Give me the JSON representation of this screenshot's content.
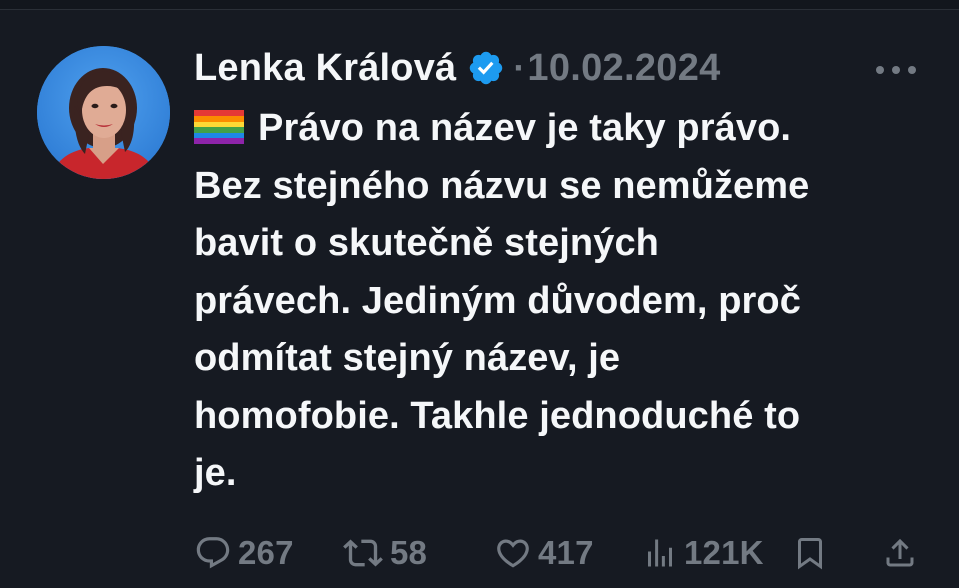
{
  "post": {
    "author_name": "Lenka Králová",
    "verified_icon": "verified-badge-icon",
    "separator": "·",
    "timestamp": "10.02.2024",
    "more_icon": "more-options-icon",
    "flag_icon": "rainbow-flag-icon",
    "text_lines": [
      "Právo na název je taky právo.",
      "Bez stejného názvu se nemůžeme",
      "bavit o skutečně stejných",
      "právech. Jediným důvodem, proč",
      "odmítat stejný název, je",
      "homofobie. Takhle jednoduché to",
      "je."
    ]
  },
  "actions": {
    "replies": {
      "icon": "reply-icon",
      "count": "267"
    },
    "reposts": {
      "icon": "repost-icon",
      "count": "58"
    },
    "likes": {
      "icon": "heart-icon",
      "count": "417"
    },
    "views": {
      "icon": "views-chart-icon",
      "count": "121K"
    },
    "bookmark": {
      "icon": "bookmark-icon"
    },
    "share": {
      "icon": "share-icon"
    }
  },
  "colors": {
    "background": "#161a22",
    "text": "#f5f7f9",
    "muted": "#737a83",
    "verified": "#1d9bf0"
  }
}
